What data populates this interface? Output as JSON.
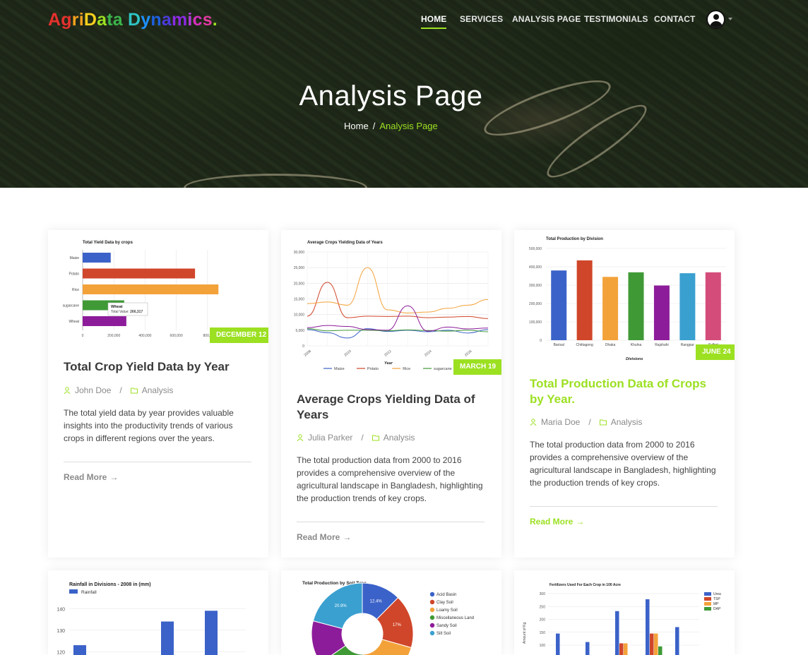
{
  "header": {
    "logo_parts": [
      "A",
      "g",
      "r",
      "i",
      "D",
      "a",
      "t",
      "a",
      " ",
      "D",
      "y",
      "n",
      "a",
      "m",
      "i",
      "c",
      "s",
      "."
    ],
    "logo_colors": [
      "#e5322d",
      "#e5322d",
      "#f6a21e",
      "#f6a21e",
      "#f6d01e",
      "#9ce022",
      "#3cb44b",
      "#3cb44b",
      " ",
      "#2ec4c4",
      "#1e90ff",
      "#1e60e0",
      "#4b3cdc",
      "#8a2be2",
      "#b23cdc",
      "#d42fbe",
      "#e03ca0",
      "#9ce022"
    ],
    "nav": [
      "HOME",
      "SERVICES",
      "ANALYSIS PAGE",
      "TESTIMONIALS",
      "CONTACT"
    ],
    "active_nav": "HOME",
    "user_icon": "user-circle-icon"
  },
  "hero": {
    "title": "Analysis Page",
    "breadcrumb_home": "Home",
    "breadcrumb_sep": "/",
    "breadcrumb_current": "Analysis Page"
  },
  "accent": "#9ce022",
  "cards": [
    {
      "badge": "DECEMBER 12",
      "title": "Total Crop Yield Data by Year",
      "author": "John Doe",
      "category": "Analysis",
      "description": "The total yield data by year provides valuable insights into the productivity trends of various crops in different regions over the years.",
      "read_more": "Read More"
    },
    {
      "badge": "MARCH 19",
      "title": "Average Crops Yielding Data of Years",
      "author": "Julia Parker",
      "category": "Analysis",
      "description": "The total production data from 2000 to 2016 provides a comprehensive overview of the agricultural landscape in Bangladesh, highlighting the production trends of key crops.",
      "read_more": "Read More"
    },
    {
      "badge": "JUNE 24",
      "title": "Total Production Data of Crops by Year.",
      "author": "Maria Doe",
      "category": "Analysis",
      "description": "The total production data from 2000 to 2016 provides a comprehensive overview of the agricultural landscape in Bangladesh, highlighting the production trends of key crops.",
      "read_more": "Read More"
    }
  ],
  "chart_data": [
    {
      "type": "bar",
      "orientation": "horizontal",
      "title": "Total Yield Data by crops",
      "categories": [
        "Maize",
        "Potato",
        "Rice",
        "sugarcane",
        "Wheat"
      ],
      "values": [
        180000,
        720000,
        870000,
        266317,
        280000
      ],
      "colors": [
        "#3b62c8",
        "#d0462a",
        "#f3a23a",
        "#3f9a36",
        "#8d1c9a"
      ],
      "x_ticks": [
        "0",
        "200,000",
        "400,000",
        "600,000",
        "800,0"
      ],
      "xlim": [
        0,
        1000000
      ],
      "tooltip": {
        "name": "Wheat",
        "label": "Total Value:",
        "value": "266,317"
      }
    },
    {
      "type": "line",
      "title": "Average Crops Yielding Data of Years",
      "xlabel": "Year",
      "x": [
        2008,
        2009,
        2010,
        2011,
        2012,
        2013,
        2014,
        2015,
        2016,
        2017
      ],
      "x_ticks": [
        "2008",
        "2010",
        "2012",
        "2014",
        "2016"
      ],
      "y_ticks": [
        "0",
        "5,000",
        "10,000",
        "15,000",
        "20,000",
        "25,000",
        "30,000"
      ],
      "ylim": [
        0,
        30000
      ],
      "series": [
        {
          "name": "Maize",
          "color": "#3b62c8",
          "values": [
            5200,
            4200,
            2500,
            5500,
            4600,
            5000,
            4500,
            5000,
            4100,
            5200
          ]
        },
        {
          "name": "Potato",
          "color": "#d0462a",
          "values": [
            9500,
            20300,
            9000,
            9500,
            9400,
            9500,
            9000,
            9200,
            9400,
            8700
          ]
        },
        {
          "name": "Rice",
          "color": "#f3a23a",
          "values": [
            13500,
            14000,
            13000,
            25000,
            11500,
            10500,
            10800,
            12000,
            13000,
            14800
          ]
        },
        {
          "name": "sugarcane",
          "color": "#3f9a36",
          "values": [
            5500,
            4800,
            5000,
            5000,
            4800,
            5100,
            4900,
            4700,
            5000,
            4500
          ]
        },
        {
          "name": "Wheat",
          "color": "#8d1c9a",
          "values": [
            5800,
            6500,
            6200,
            5200,
            5000,
            12800,
            4700,
            6000,
            5400,
            5700
          ]
        }
      ]
    },
    {
      "type": "bar",
      "title": "Total Production by Division",
      "xlabel": "Divisions",
      "categories": [
        "Barisal",
        "Chittagong",
        "Dhaka",
        "Khulna",
        "Rajshahi",
        "Rangpur",
        "Sylhet"
      ],
      "values": [
        380000,
        435000,
        345000,
        370000,
        298000,
        365000,
        370000
      ],
      "colors": [
        "#3b62c8",
        "#d0462a",
        "#f3a23a",
        "#3f9a36",
        "#8d1c9a",
        "#3aa0d0",
        "#d44d7a"
      ],
      "y_ticks": [
        "0",
        "100,000",
        "200,000",
        "300,000",
        "400,000",
        "500,000"
      ],
      "ylim": [
        0,
        500000
      ]
    },
    {
      "type": "bar",
      "title": "Rainfall in Divisions - 2008 in (mm)",
      "series_name": "Rainfall",
      "color": "#3b62c8",
      "values": [
        123,
        109,
        117,
        102,
        134,
        111,
        139,
        115
      ],
      "y_ticks": [
        "110",
        "120",
        "130",
        "140"
      ],
      "ylim": [
        105,
        145
      ]
    },
    {
      "type": "pie",
      "title": "Total Production by Soil Type",
      "labels": [
        "Acid Basin",
        "Clay Soil",
        "Loamy Soil",
        "Miscellaneous Land",
        "Sandy Soil",
        "Silt Soil"
      ],
      "colors": [
        "#3b62c8",
        "#d0462a",
        "#f3a23a",
        "#3f9a36",
        "#8d1c9a",
        "#3aa0d0"
      ],
      "values": [
        12.4,
        17,
        20,
        15.9,
        13.8,
        20.9
      ],
      "slice_labels": [
        "12.4%",
        "17%",
        "",
        "",
        "",
        "20.9%"
      ]
    },
    {
      "type": "bar",
      "title": "Fertilizers Used For Each Crop in 100 Acre",
      "ylabel": "Amount of Kg",
      "legend": [
        "Urea",
        "TSP",
        "MP",
        "DAP"
      ],
      "colors": [
        "#3b62c8",
        "#d0462a",
        "#f3a23a",
        "#3f9a36"
      ],
      "y_ticks": [
        "100",
        "150",
        "200",
        "250",
        "300"
      ],
      "ylim": [
        80,
        310
      ],
      "groups": [
        [
          145,
          0,
          0,
          0
        ],
        [
          112,
          0,
          0,
          0
        ],
        [
          232,
          107,
          107,
          0
        ],
        [
          278,
          145,
          145,
          95
        ],
        [
          170,
          0,
          0,
          0
        ]
      ]
    }
  ]
}
